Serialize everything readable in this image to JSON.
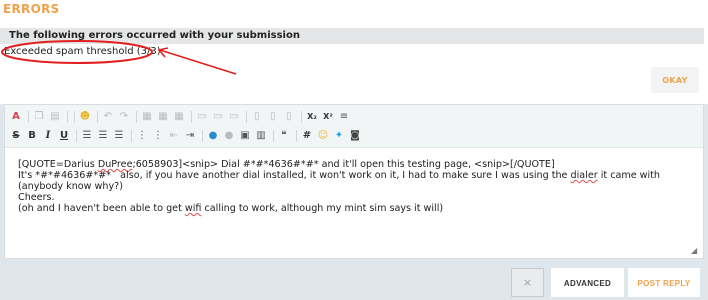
{
  "errors": {
    "title": "ERRORS",
    "subtitle": "The following errors occurred with your submission",
    "items": [
      "Exceeded spam threshold (3/3)"
    ],
    "okay_label": "OKAY"
  },
  "editor": {
    "toolbar_icons": [
      "text-color-icon",
      "copy-icon",
      "paste-icon",
      "smiley-icon",
      "undo-icon",
      "redo-icon",
      "table-icon",
      "strike-icon",
      "bold-icon",
      "italic-icon",
      "underline-icon",
      "align-left-icon",
      "align-center-icon",
      "align-right-icon",
      "list-ordered-icon",
      "list-unordered-icon",
      "outdent-icon",
      "indent-icon",
      "link-icon",
      "unlink-icon",
      "image-icon",
      "media-icon",
      "quote-icon",
      "hash-icon",
      "emoji-icon",
      "twitter-icon",
      "instagram-icon",
      "subscript-icon",
      "superscript-icon"
    ],
    "line1a": "[QUOTE=Darius ",
    "line1b": "DuPree",
    "line1c": ";6058903]<snip> Dial #*#*4636#*#* and it'll open this testing page, <snip>[/QUOTE]",
    "line2a": "It's *#*#4636#*#*   also, if you have another dial installed, it won't work on it, I had to make sure I was using the ",
    "line2b": "dialer",
    "line2c": " it came with (anybody know why?)",
    "line3": "Cheers.",
    "line4a": "(oh and I haven't been able to get ",
    "line4b": "wifi",
    "line4c": " calling to work, although my mint sim says it will)"
  },
  "actions": {
    "disabled_label": "×",
    "advanced_label": "ADVANCED",
    "post_label": "POST REPLY"
  },
  "colors": {
    "accent": "#f0a24a",
    "annotation": "#e02020"
  }
}
